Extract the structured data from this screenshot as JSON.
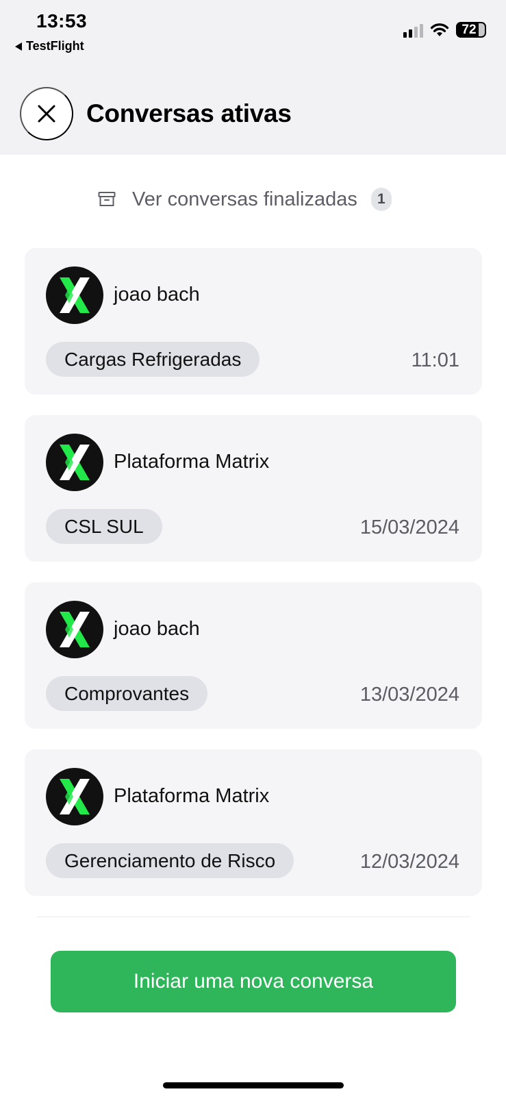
{
  "status_bar": {
    "time": "13:53",
    "back_app_label": "TestFlight",
    "battery_level": "72",
    "icons": [
      "cellular-signal-icon",
      "wifi-icon",
      "battery-icon"
    ]
  },
  "header": {
    "title": "Conversas ativas",
    "close_icon": "close-icon"
  },
  "finished_link": {
    "label": "Ver conversas finalizadas",
    "count": "1",
    "icon": "archive-icon"
  },
  "conversations": [
    {
      "name": "joao bach",
      "tag": "Cargas Refrigeradas",
      "time": "11:01",
      "avatar_icon": "matrix-x-logo-icon"
    },
    {
      "name": "Plataforma Matrix",
      "tag": "CSL SUL",
      "time": "15/03/2024",
      "avatar_icon": "matrix-x-logo-icon"
    },
    {
      "name": "joao bach",
      "tag": "Comprovantes",
      "time": "13/03/2024",
      "avatar_icon": "matrix-x-logo-icon"
    },
    {
      "name": "Plataforma Matrix",
      "tag": "Gerenciamento de Risco",
      "time": "12/03/2024",
      "avatar_icon": "matrix-x-logo-icon"
    }
  ],
  "actions": {
    "new_conversation_label": "Iniciar uma nova conversa"
  },
  "colors": {
    "header_background": "#f2f2f4",
    "card_background": "#f5f5f7",
    "tag_background": "#dfe1e6",
    "primary_button": "#2fb65b",
    "logo_green": "#22e84a"
  }
}
